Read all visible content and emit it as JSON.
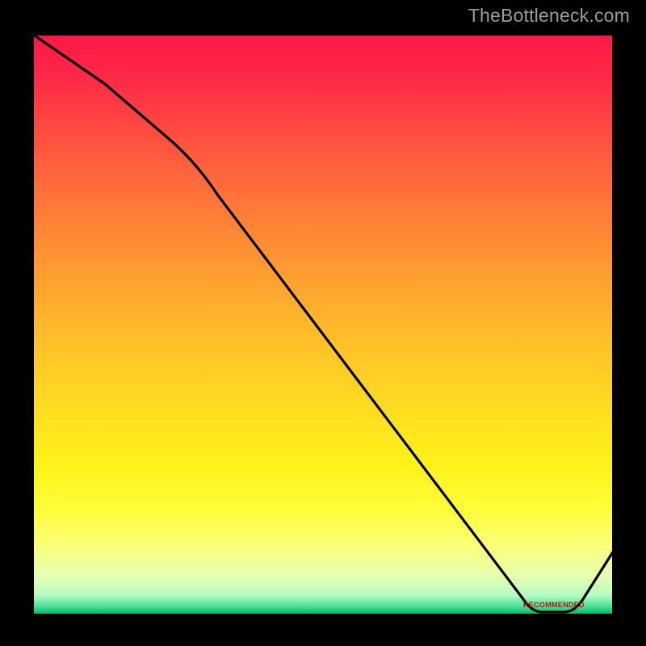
{
  "watermark": "TheBottleneck.com",
  "annotation_text": "RECOMMENDED",
  "chart_data": {
    "type": "line",
    "title": "",
    "xlabel": "",
    "ylabel": "",
    "xlim": [
      0,
      100
    ],
    "ylim": [
      0,
      100
    ],
    "series": [
      {
        "name": "curve",
        "x": [
          0,
          10,
          22,
          30,
          40,
          50,
          60,
          70,
          80,
          86,
          90,
          94,
          100
        ],
        "y": [
          100,
          92,
          82,
          74,
          62,
          50,
          38,
          26,
          12,
          2,
          0,
          2,
          10
        ]
      }
    ],
    "optimal_range_x": [
      86,
      94
    ],
    "background_gradient": {
      "top": "#ff1747",
      "mid": "#ffe020",
      "bottom": "#0aa862"
    }
  }
}
